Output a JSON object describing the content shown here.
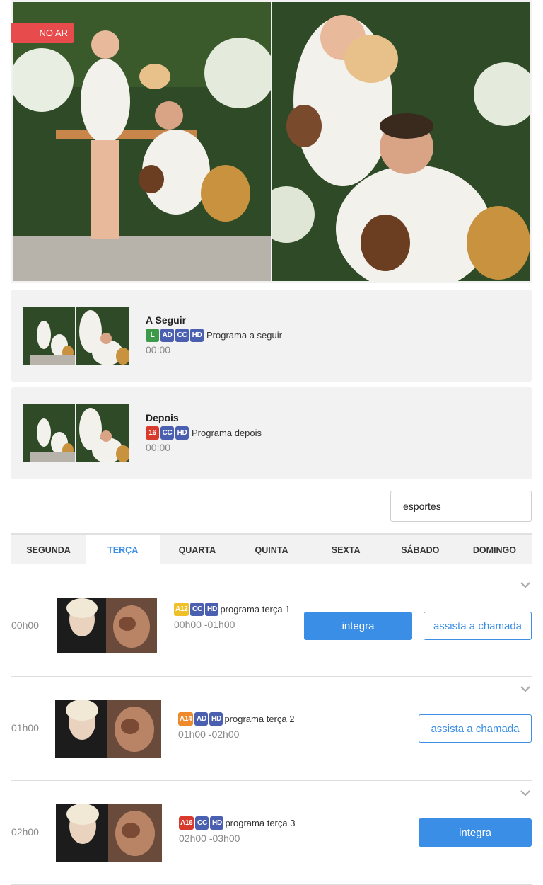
{
  "live": {
    "badge": "NO AR"
  },
  "next_programs": [
    {
      "title": "A Seguir",
      "badges": [
        {
          "text": "L",
          "color": "#3d9a4a"
        },
        {
          "text": "AD",
          "color": "#4b5fb0"
        },
        {
          "text": "CC",
          "color": "#4b5fb0"
        },
        {
          "text": "HD",
          "color": "#4b5fb0"
        }
      ],
      "label": "Programa a seguir",
      "time": "00:00"
    },
    {
      "title": "Depois",
      "badges": [
        {
          "text": "16",
          "color": "#d83a2e"
        },
        {
          "text": "CC",
          "color": "#4b5fb0"
        },
        {
          "text": "HD",
          "color": "#4b5fb0"
        }
      ],
      "label": "Programa depois",
      "time": "00:00"
    }
  ],
  "search": {
    "value": "esportes"
  },
  "tabs": [
    {
      "label": "SEGUNDA"
    },
    {
      "label": "TERÇA"
    },
    {
      "label": "QUARTA"
    },
    {
      "label": "QUINTA"
    },
    {
      "label": "SEXTA"
    },
    {
      "label": "SÁBADO"
    },
    {
      "label": "DOMINGO"
    }
  ],
  "schedule": [
    {
      "hour": "00h00",
      "badges": [
        {
          "text": "A12",
          "color": "#f0c02a"
        },
        {
          "text": "CC",
          "color": "#4b5fb0"
        },
        {
          "text": "HD",
          "color": "#4b5fb0"
        }
      ],
      "title": "programa terça 1",
      "time": "00h00 -01h00",
      "integra_label": "integra",
      "chamada_label": "assista a chamada"
    },
    {
      "hour": "01h00",
      "badges": [
        {
          "text": "A14",
          "color": "#ee8a2c"
        },
        {
          "text": "AD",
          "color": "#4b5fb0"
        },
        {
          "text": "HD",
          "color": "#4b5fb0"
        }
      ],
      "title": "programa terça 2",
      "time": "01h00 -02h00",
      "chamada_label": "assista a chamada"
    },
    {
      "hour": "02h00",
      "badges": [
        {
          "text": "A16",
          "color": "#d83a2e"
        },
        {
          "text": "CC",
          "color": "#4b5fb0"
        },
        {
          "text": "HD",
          "color": "#4b5fb0"
        }
      ],
      "title": "programa terça 3",
      "time": "02h00 -03h00",
      "integra_label": "integra"
    }
  ],
  "colors": {
    "accent": "#3a8ee6",
    "live": "#e74b4b",
    "panel": "#f2f2f2"
  }
}
